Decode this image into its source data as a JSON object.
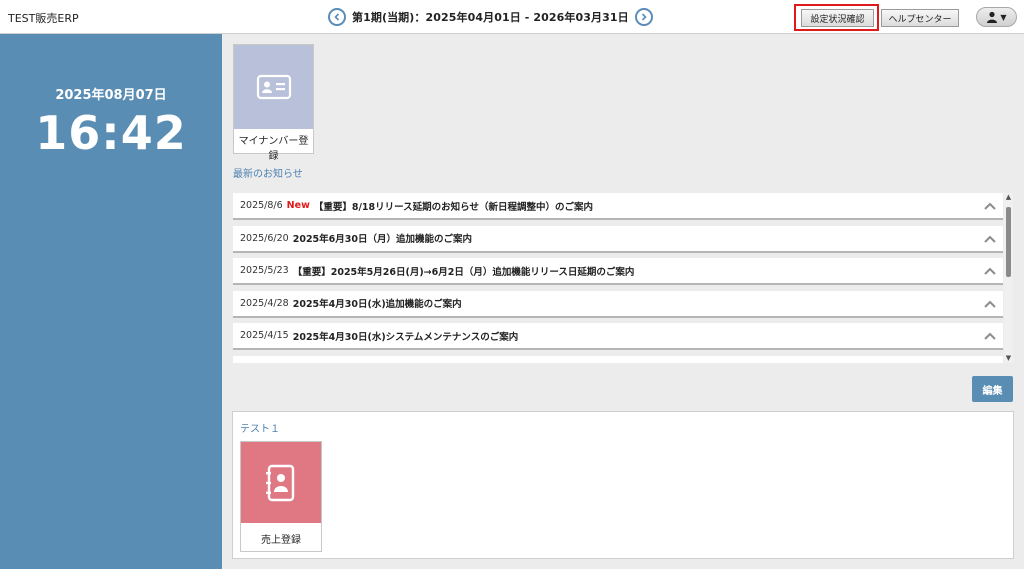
{
  "header": {
    "app_title": "TEST販売ERP",
    "period": "第1期(当期)：2025年04月01日 - 2026年03月31日",
    "settings_button": "設定状況確認",
    "help_button": "ヘルプセンター",
    "user_caret": "▼",
    "icons": {
      "prev": "chevron-left-icon",
      "next": "chevron-right-icon",
      "user": "user-icon"
    },
    "colors": {
      "nav_circle": "#5a8cb8",
      "highlight": "#e01a1a"
    }
  },
  "left_panel": {
    "date": "2025年08月07日",
    "time": "16:42",
    "color": "#5a8db4"
  },
  "tiles": {
    "mynumber": {
      "label": "マイナンバー登録",
      "icon": "id-card-icon",
      "color": "#b9c0d9"
    },
    "sales": {
      "label": "売上登録",
      "icon": "contact-book-icon",
      "color": "#df7883"
    }
  },
  "news": {
    "heading": "最新のお知らせ",
    "items": [
      {
        "date": "2025/8/6",
        "badge": "New",
        "title": "【重要】8/18リリース延期のお知らせ（新日程調整中）のご案内"
      },
      {
        "date": "2025/6/20",
        "badge": "",
        "title": "2025年6月30日（月）追加機能のご案内"
      },
      {
        "date": "2025/5/23",
        "badge": "",
        "title": "【重要】2025年5月26日(月)→6月2日（月）追加機能リリース日延期のご案内"
      },
      {
        "date": "2025/4/28",
        "badge": "",
        "title": "2025年4月30日(水)追加機能のご案内"
      },
      {
        "date": "2025/4/15",
        "badge": "",
        "title": "2025年4月30日(水)システムメンテナンスのご案内"
      }
    ],
    "scroll_up": "▲",
    "scroll_down": "▼"
  },
  "edit_button": "編集",
  "group": {
    "title": "テスト１"
  }
}
